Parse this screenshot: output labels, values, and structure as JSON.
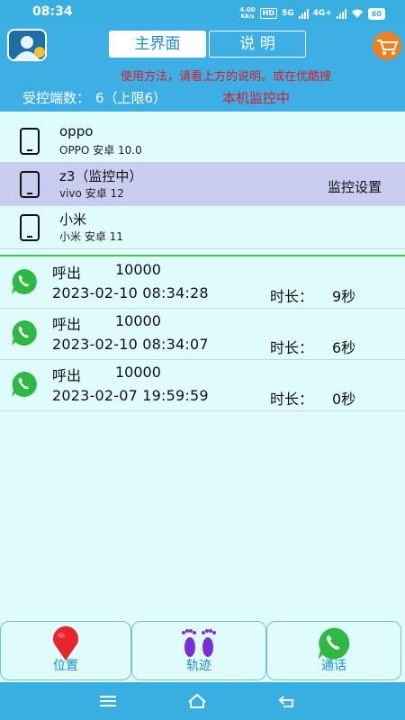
{
  "status_bar": {
    "time": "08:34",
    "net_speed": "4.00",
    "net_unit": "KB/s",
    "hd": "HD",
    "signal1": "5G",
    "signal2": "4G+",
    "battery": "60"
  },
  "header": {
    "tab_main": "主界面",
    "tab_help": "说 明",
    "marquee": "使用方法，请看上方的说明。或在优酷搜",
    "count_label": "受控端数：",
    "count_value": "6（上限6）",
    "monitor_status": "本机监控中"
  },
  "devices": [
    {
      "name": "oppo",
      "sub": "OPPO 安卓 10.0",
      "setting": ""
    },
    {
      "name": "z3（监控中）",
      "sub": "vivo 安卓 12",
      "setting": "监控设置"
    },
    {
      "name": "小米",
      "sub": "小米 安卓 11",
      "setting": ""
    }
  ],
  "calls": [
    {
      "type": "呼出",
      "number": "10000",
      "time": "2023-02-10 08:34:28",
      "dur_label": "时长：",
      "dur": "9秒"
    },
    {
      "type": "呼出",
      "number": "10000",
      "time": "2023-02-10 08:34:07",
      "dur_label": "时长：",
      "dur": "6秒"
    },
    {
      "type": "呼出",
      "number": "10000",
      "time": "2023-02-07 19:59:59",
      "dur_label": "时长：",
      "dur": "0秒"
    }
  ],
  "bottom_nav": {
    "location": "位置",
    "track": "轨迹",
    "calls": "通话"
  },
  "colors": {
    "header_bg": "#3dafe4",
    "accent_red": "#d81b28",
    "selected_row": "#c8cdf0",
    "page_bg": "#e0fbfb"
  },
  "icons": {
    "avatar": "user-avatar-icon",
    "cart": "shopping-cart-icon",
    "device": "phone-icon",
    "call": "whatsapp-icon",
    "location": "map-pin-icon",
    "track": "footprints-icon"
  }
}
